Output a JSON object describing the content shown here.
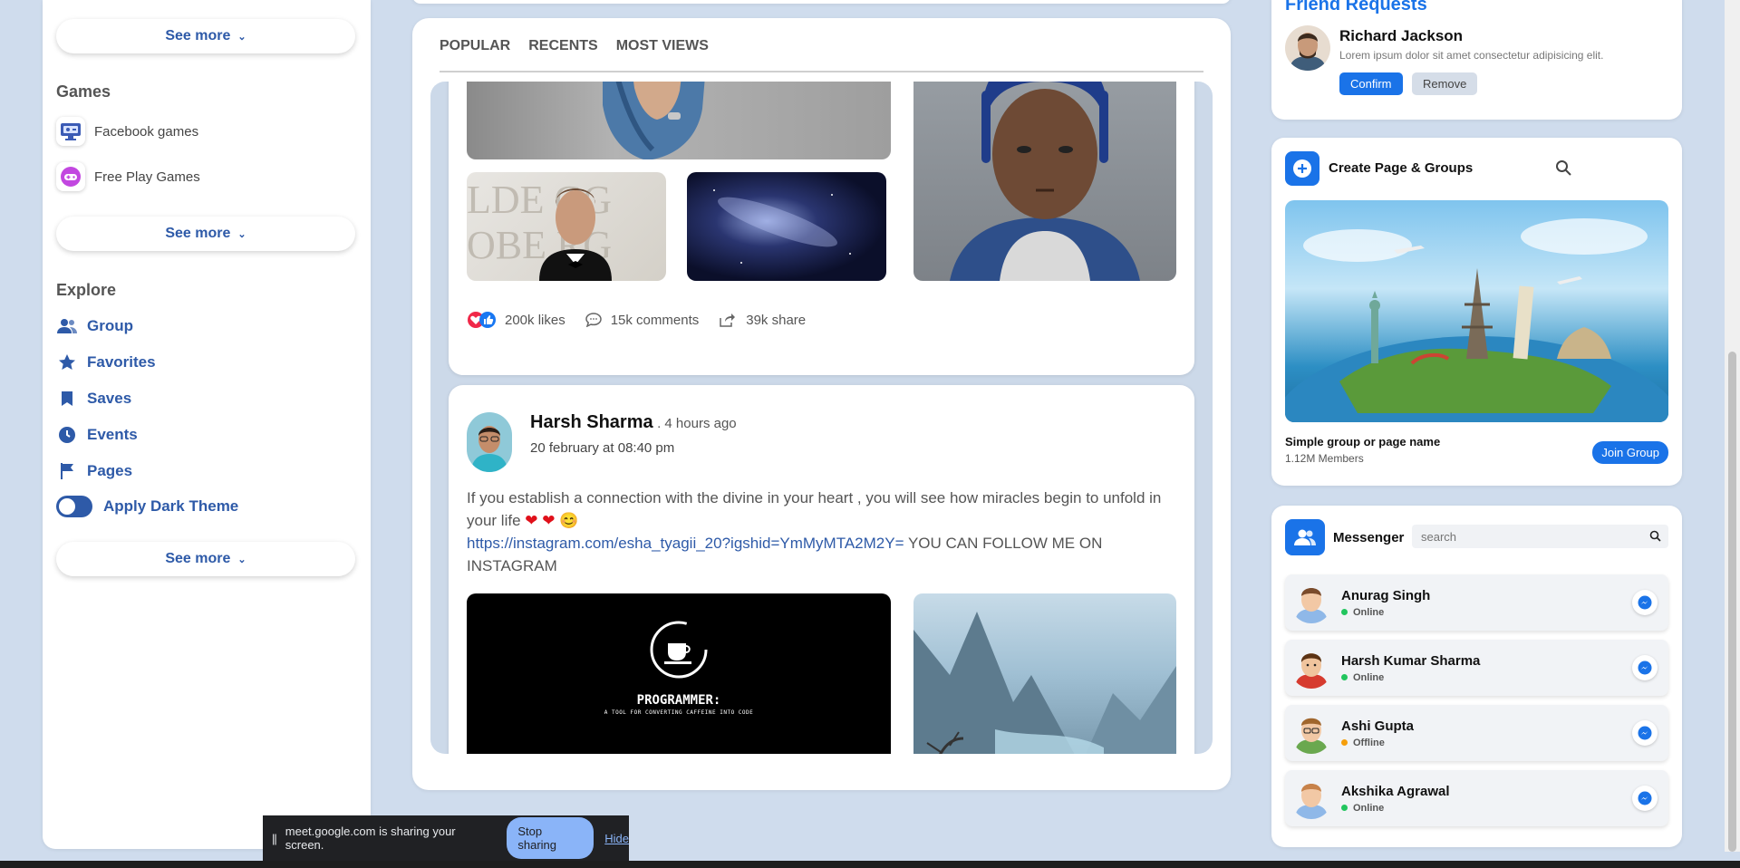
{
  "left_sidebar": {
    "see_more_1": "See more",
    "games_title": "Games",
    "games": [
      {
        "label": "Facebook games",
        "icon": "game-console-icon"
      },
      {
        "label": "Free Play Games",
        "icon": "gamepad-icon"
      }
    ],
    "see_more_2": "See more",
    "explore_title": "Explore",
    "explore": [
      {
        "label": "Group",
        "icon": "group-icon"
      },
      {
        "label": "Favorites",
        "icon": "star-icon"
      },
      {
        "label": "Saves",
        "icon": "bookmark-icon"
      },
      {
        "label": "Events",
        "icon": "clock-icon"
      },
      {
        "label": "Pages",
        "icon": "flag-icon"
      }
    ],
    "dark_theme_label": "Apply Dark Theme",
    "see_more_3": "See more"
  },
  "feed": {
    "tabs": [
      "POPULAR",
      "RECENTS",
      "MOST VIEWS"
    ],
    "post1": {
      "likes": "200k likes",
      "comments": "15k comments",
      "shares": "39k share"
    },
    "post2": {
      "author": "Harsh Sharma",
      "time": ". 4 hours ago",
      "date": "20 february at 08:40 pm",
      "text_1": "If you establish a connection with the divine in your heart , you will see how miracles begin to unfold in your life",
      "emojis": "❤ ❤ 😊",
      "link": "https://instagram.com/esha_tyagii_20?igshid=YmMyMTA2M2Y=",
      "text_2": " YOU CAN FOLLOW ME ON INSTAGRAM",
      "image_title": "PROGRAMMER:",
      "image_subtitle": "A TOOL FOR CONVERTING CAFFEINE INTO CODE"
    }
  },
  "right": {
    "friend_requests_title": "Friend Requests",
    "request": {
      "name": "Richard Jackson",
      "text": "Lorem ipsum dolor sit amet consectetur adipisicing elit.",
      "confirm": "Confirm",
      "remove": "Remove"
    },
    "create_title": "Create Page & Groups",
    "group_name": "Simple group or page name",
    "group_members": "1.12M Members",
    "join_label": "Join Group",
    "messenger_title": "Messenger",
    "search_placeholder": "search",
    "contacts": [
      {
        "name": "Anurag Singh",
        "status": "Online",
        "status_color": "#22c55e"
      },
      {
        "name": "Harsh Kumar Sharma",
        "status": "Online",
        "status_color": "#22c55e"
      },
      {
        "name": "Ashi Gupta",
        "status": "Offline",
        "status_color": "#f59e0b"
      },
      {
        "name": "Akshika Agrawal",
        "status": "Online",
        "status_color": "#22c55e"
      }
    ]
  },
  "share_bar": {
    "pause_icon": "||",
    "message": "meet.google.com is sharing your screen.",
    "stop": "Stop sharing",
    "hide": "Hide"
  },
  "colors": {
    "accent": "#2e5aa8",
    "button_blue": "#1a73e8",
    "background": "#cfdced"
  }
}
